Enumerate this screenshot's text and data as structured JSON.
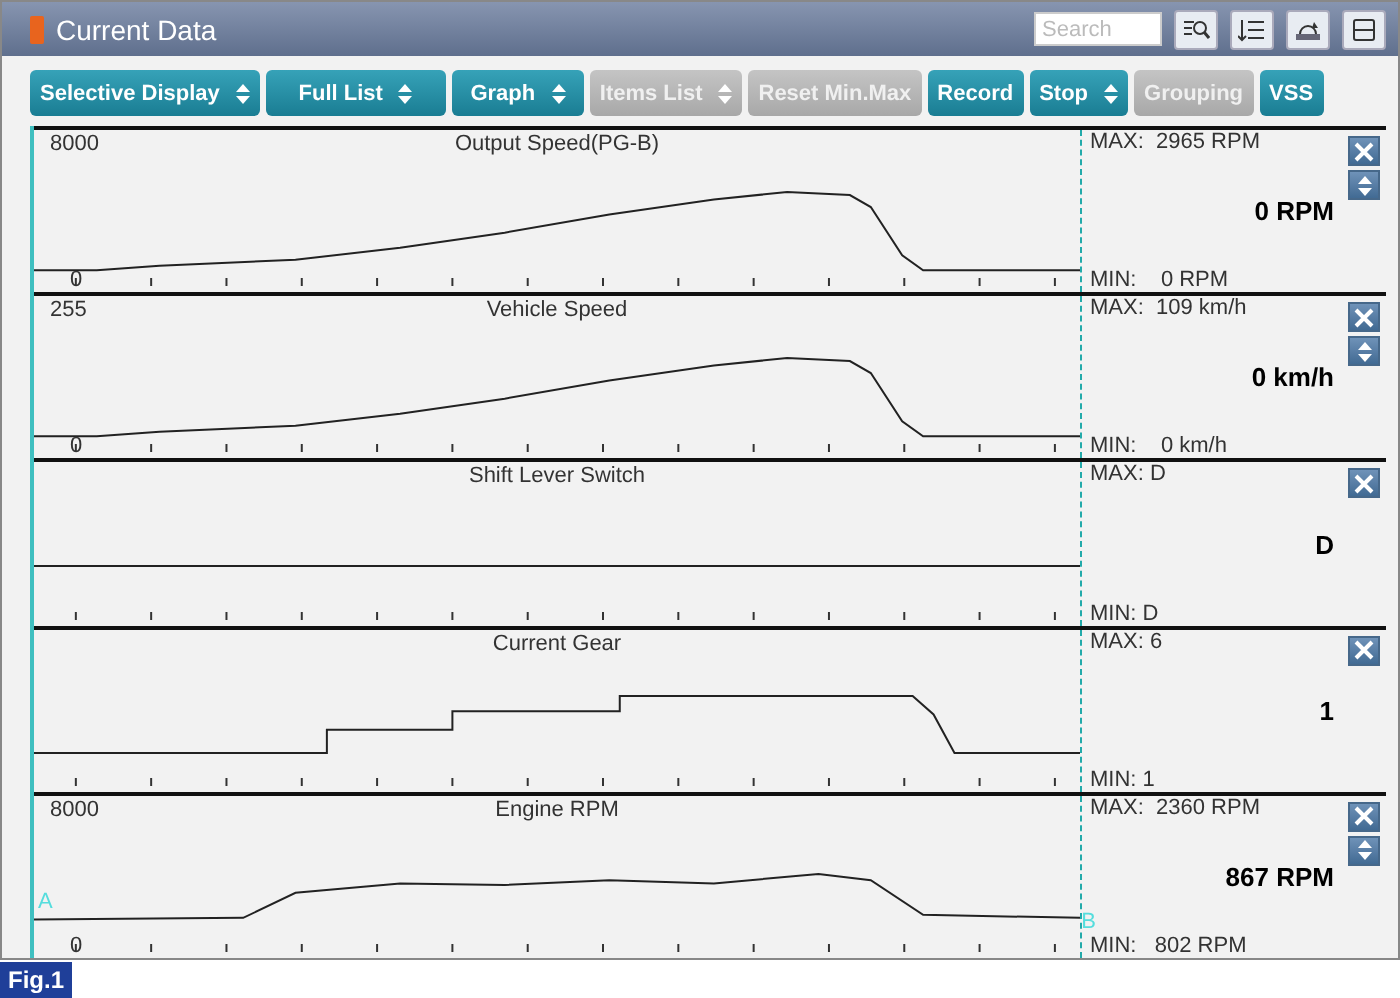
{
  "window": {
    "title": "Current Data",
    "search_placeholder": "Search"
  },
  "toolbar": [
    {
      "label": "Selective Display",
      "dropdown": true,
      "disabled": false
    },
    {
      "label": "Full List",
      "dropdown": true,
      "disabled": false
    },
    {
      "label": "Graph",
      "dropdown": true,
      "disabled": false
    },
    {
      "label": "Items List",
      "dropdown": true,
      "disabled": true
    },
    {
      "label": "Reset Min.Max",
      "dropdown": false,
      "disabled": true
    },
    {
      "label": "Record",
      "dropdown": false,
      "disabled": false
    },
    {
      "label": "Stop",
      "dropdown": true,
      "disabled": false
    },
    {
      "label": "Grouping",
      "dropdown": false,
      "disabled": true
    },
    {
      "label": "VSS",
      "dropdown": false,
      "disabled": false
    }
  ],
  "panels": [
    {
      "title": "Output Speed(PG-B)",
      "ymax": "8000",
      "ymin": "0",
      "max": "MAX:  2965 RPM",
      "value": "0 RPM",
      "min": "MIN:    0 RPM",
      "kind": "hump",
      "resizable": true
    },
    {
      "title": "Vehicle Speed",
      "ymax": "255",
      "ymin": "0",
      "max": "MAX:  109 km/h",
      "value": "0 km/h",
      "min": "MIN:    0 km/h",
      "kind": "hump",
      "resizable": true
    },
    {
      "title": "Shift Lever Switch",
      "max": "MAX: D",
      "value": "D",
      "min": "MIN: D",
      "kind": "flat",
      "resizable": false
    },
    {
      "title": "Current Gear",
      "max": "MAX: 6",
      "value": "1",
      "min": "MIN: 1",
      "kind": "steps",
      "resizable": false
    },
    {
      "title": "Engine RPM",
      "ymax": "8000",
      "ymin": "0",
      "max": "MAX:  2360 RPM",
      "value": "867 RPM",
      "min": "MIN:   802 RPM",
      "kind": "wavy",
      "resizable": true,
      "cursor_a": "A",
      "cursor_b": "B"
    }
  ],
  "figure_label": "Fig.1"
}
